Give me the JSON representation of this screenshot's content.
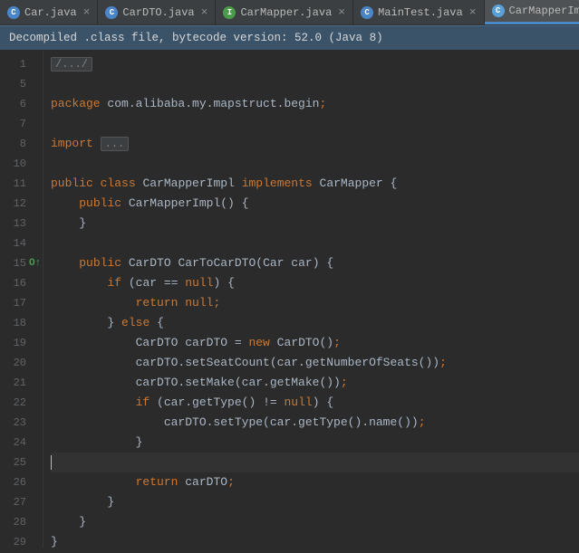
{
  "tabs": [
    {
      "label": "Car.java",
      "icon": "C",
      "iconClass": "icon-class"
    },
    {
      "label": "CarDTO.java",
      "icon": "C",
      "iconClass": "icon-class"
    },
    {
      "label": "CarMapper.java",
      "icon": "I",
      "iconClass": "icon-interface"
    },
    {
      "label": "MainTest.java",
      "icon": "C",
      "iconClass": "icon-class"
    },
    {
      "label": "CarMapperImpl.class",
      "icon": "C",
      "iconClass": "icon-impl",
      "active": true
    }
  ],
  "banner": "Decompiled .class file, bytecode version: 52.0 (Java 8)",
  "gutter": {
    "lines": [
      "1",
      "5",
      "6",
      "7",
      "8",
      "10",
      "11",
      "12",
      "13",
      "14",
      "15",
      "16",
      "17",
      "18",
      "19",
      "20",
      "21",
      "22",
      "23",
      "24",
      "25",
      "26",
      "27",
      "28",
      "29"
    ],
    "override_at": "15",
    "folds": [
      "1",
      "6",
      "8",
      "11",
      "12",
      "13",
      "15",
      "16",
      "18",
      "22",
      "24",
      "27",
      "28",
      "29"
    ]
  },
  "code": {
    "l1_fold": "/.../",
    "l6_kw": "package",
    "l6_pkg": "com.alibaba.my.mapstruct.begin",
    "l8_kw": "import",
    "l8_fold": "...",
    "l11_kw1": "public",
    "l11_kw2": "class",
    "l11_name": "CarMapperImpl",
    "l11_kw3": "implements",
    "l11_iface": "CarMapper",
    "l11_brace": "{",
    "l12_kw": "public",
    "l12_ctor": "CarMapperImpl()",
    "l12_brace": "{",
    "l13_brace": "}",
    "l15_kw": "public",
    "l15_ret": "CarDTO",
    "l15_name": "CarToCarDTO(Car car)",
    "l15_brace": "{",
    "l16_kw": "if",
    "l16_cond1": "(car == ",
    "l16_null": "null",
    "l16_cond2": ")",
    "l16_brace": "{",
    "l17_kw": "return",
    "l17_null": "null",
    "l18_brace1": "}",
    "l18_kw": "else",
    "l18_brace2": "{",
    "l19_type": "CarDTO carDTO = ",
    "l19_kw": "new",
    "l19_call": "CarDTO()",
    "l20": "carDTO.setSeatCount(car.getNumberOfSeats())",
    "l21": "carDTO.setMake(car.getMake())",
    "l22_kw": "if",
    "l22_cond1": "(car.getType() != ",
    "l22_null": "null",
    "l22_cond2": ")",
    "l22_brace": "{",
    "l23": "carDTO.setType(car.getType().name())",
    "l24_brace": "}",
    "l26_kw": "return",
    "l26_var": "carDTO",
    "l27_brace": "}",
    "l28_brace": "}",
    "l29_brace": "}",
    "semi": ";"
  },
  "chart_data": null
}
